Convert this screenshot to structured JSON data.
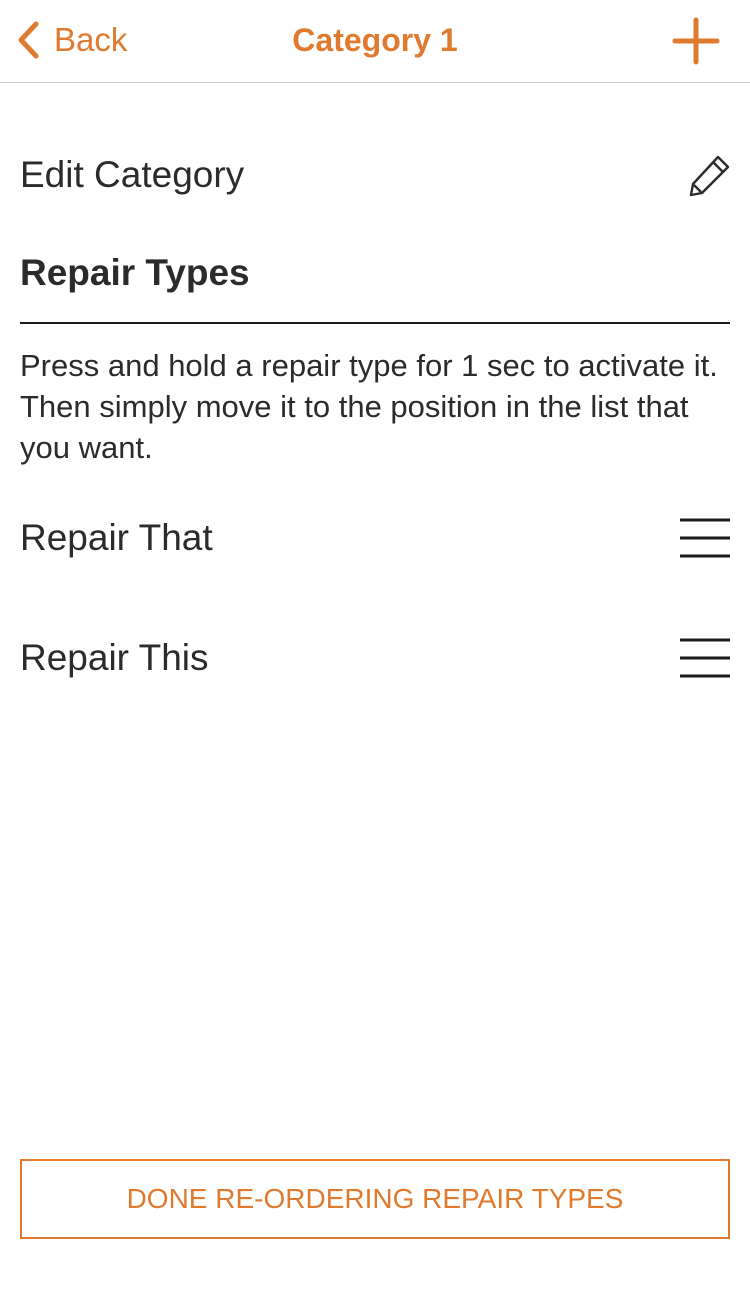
{
  "navbar": {
    "back_label": "Back",
    "title": "Category 1",
    "icons": {
      "back": "chevron-left-icon",
      "add": "plus-icon"
    }
  },
  "edit_category": {
    "label": "Edit Category",
    "icon": "pencil-icon"
  },
  "repair_types": {
    "section_title": "Repair Types",
    "instructions": "Press and hold a repair type for 1 sec to activate it.  Then simply move it to the position in the list that you want.",
    "items": [
      {
        "label": "Repair That",
        "icon": "drag-handle-icon"
      },
      {
        "label": "Repair This",
        "icon": "drag-handle-icon"
      }
    ]
  },
  "footer": {
    "done_label": "DONE RE-ORDERING REPAIR TYPES"
  },
  "colors": {
    "accent": "#e07a2e",
    "text": "#2b2b2b",
    "divider": "#1a1a1a",
    "navbar_border": "#c8c8c8",
    "background": "#ffffff"
  }
}
